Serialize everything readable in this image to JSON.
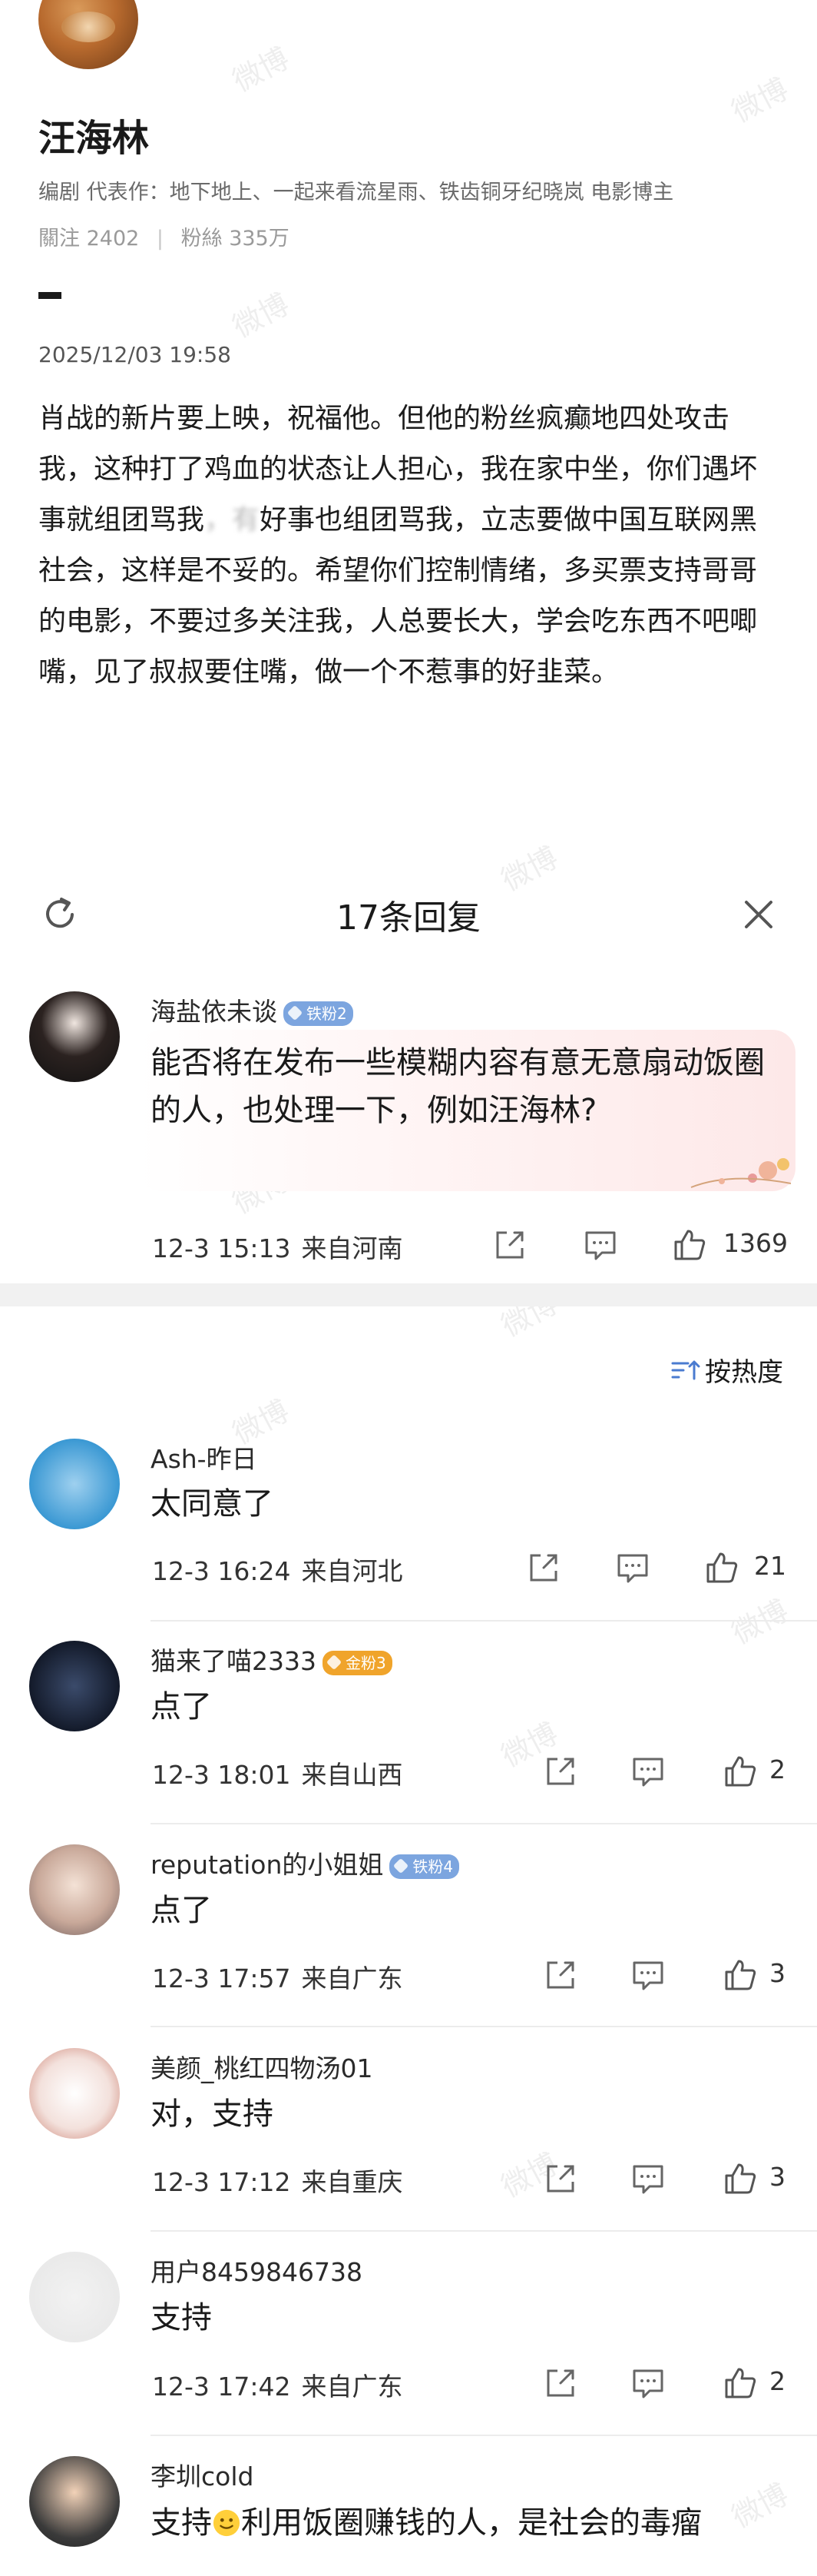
{
  "author": {
    "name": "汪海林",
    "bio": "编剧  代表作：地下地上、一起来看流星雨、铁齿铜牙纪晓岚 电影博主",
    "following_label": "關注",
    "following_count": "2402",
    "followers_label": "粉絲",
    "followers_count": "335万"
  },
  "post": {
    "timestamp": "2025/12/03 19:58",
    "body_a": "肖战的新片要上映，祝福他。但他的粉丝疯癫地四处攻击我，这种打了鸡血的状态让人担心，我在家中坐，你们遇坏事就组团骂我",
    "body_blur": "，有",
    "body_b": "好事也组团骂我，立志要做中国互联网黑社会，这样是不妥的。希望你们控制情绪，多买票支持哥哥的电影，不要过多关注我，人总要长大，学会吃东西不吧唧嘴，见了叔叔要住嘴，做一个不惹事的好韭菜。"
  },
  "sheet": {
    "title": "17条回复",
    "sort_label": "按热度"
  },
  "watermark": "微博",
  "comments": [
    {
      "name": "海盐依未谈",
      "badge": "铁粉2",
      "text": "能否将在发布一些模糊内容有意无意扇动饭圈的人，也处理一下，例如汪海林?",
      "date": "12-3 15:13",
      "loc": "来自河南",
      "likes": "1369"
    },
    {
      "name": "Ash-昨日",
      "badge": "",
      "text": "太同意了",
      "date": "12-3 16:24",
      "loc": "来自河北",
      "likes": "21"
    },
    {
      "name": "猫来了喵2333",
      "badge": "金粉3",
      "text": "点了",
      "date": "12-3 18:01",
      "loc": "来自山西",
      "likes": "2"
    },
    {
      "name": "reputation的小姐姐",
      "badge": "铁粉4",
      "text": "点了",
      "date": "12-3 17:57",
      "loc": "来自广东",
      "likes": "3"
    },
    {
      "name": "美颜_桃红四物汤01",
      "badge": "",
      "text": "对，支持",
      "date": "12-3 17:12",
      "loc": "来自重庆",
      "likes": "3"
    },
    {
      "name": "用户8459846738",
      "badge": "",
      "text": "支持",
      "date": "12-3 17:42",
      "loc": "来自广东",
      "likes": "2"
    },
    {
      "name": "李圳cold",
      "badge": "",
      "text_a": "支持",
      "text_b": "利用饭圈赚钱的人，是社会的毒瘤"
    }
  ],
  "colors": {
    "iron_badge": "#7ca5df",
    "gold_badge": "#f0a42b",
    "separator": "#f1f1f1"
  }
}
